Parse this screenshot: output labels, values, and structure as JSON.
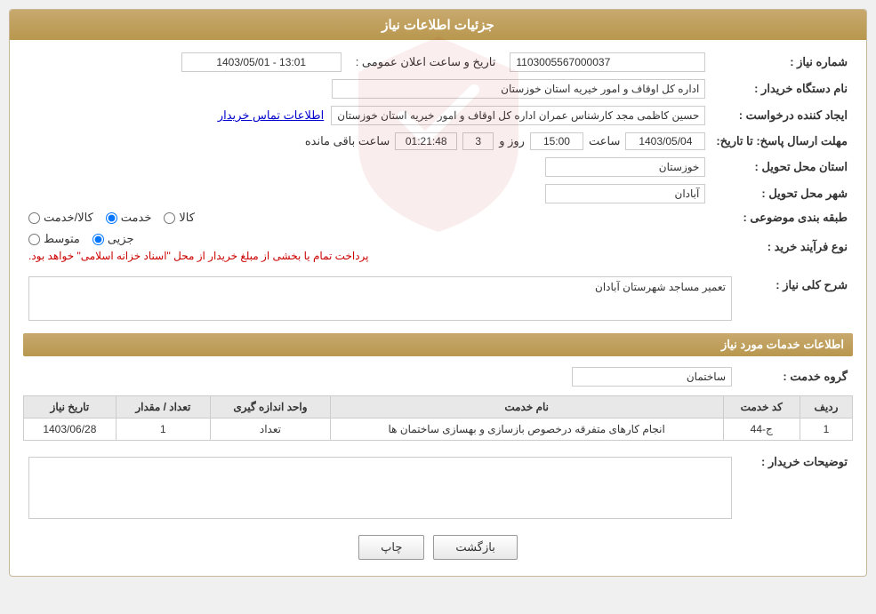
{
  "page": {
    "title": "جزئیات اطلاعات نیاز",
    "sections": {
      "main_info": "جزئیات اطلاعات نیاز",
      "services": "اطلاعات خدمات مورد نیاز"
    }
  },
  "labels": {
    "need_number": "شماره نیاز :",
    "buyer_org": "نام دستگاه خریدار :",
    "creator": "ایجاد کننده درخواست :",
    "send_date": "مهلت ارسال پاسخ: تا تاریخ:",
    "province": "استان محل تحویل :",
    "city": "شهر محل تحویل :",
    "category": "طبقه بندی موضوعی :",
    "purchase_type": "نوع فرآیند خرید :",
    "description_label": "شرح کلی نیاز :",
    "service_group": "گروه خدمت :",
    "buyer_notes_label": "توضیحات خریدار :",
    "public_announce": "تاریخ و ساعت اعلان عمومی :",
    "date_label": "تاریخ",
    "time_label": "ساعت",
    "day_label": "روز و",
    "remaining_label": "ساعت باقی مانده"
  },
  "values": {
    "need_number": "1103005567000037",
    "buyer_org": "اداره کل اوقاف و امور خیریه استان خوزستان",
    "creator_name": "حسین کاظمی مجد کارشناس عمران اداره کل اوقاف و امور خیریه استان خوزستان",
    "creator_link": "اطلاعات تماس خریدار",
    "announce_datetime": "1403/05/01 - 13:01",
    "deadline_date": "1403/05/04",
    "deadline_time": "15:00",
    "deadline_days": "3",
    "deadline_remaining": "01:21:48",
    "province": "خوزستان",
    "city": "آبادان",
    "category_goods": "کالا",
    "category_service": "خدمت",
    "category_both": "کالا/خدمت",
    "category_selected": "service",
    "purchase_type_partial": "جزیی",
    "purchase_type_medium": "متوسط",
    "purchase_notice": "پرداخت تمام یا بخشی از مبلغ خریدار از محل \"اسناد خزانه اسلامی\" خواهد بود.",
    "description": "تعمیر مساجد شهرستان آبادان",
    "service_group": "ساختمان",
    "buyer_notes": "",
    "services_table": {
      "headers": [
        "ردیف",
        "کد خدمت",
        "نام خدمت",
        "واحد اندازه گیری",
        "تعداد / مقدار",
        "تاریخ نیاز"
      ],
      "rows": [
        {
          "row": "1",
          "code": "ج-44",
          "name": "انجام کارهای متفرقه درخصوص بازسازی و بهسازی ساختمان ها",
          "unit": "تعداد",
          "quantity": "1",
          "date": "1403/06/28"
        }
      ]
    }
  },
  "buttons": {
    "print": "چاپ",
    "back": "بازگشت"
  }
}
